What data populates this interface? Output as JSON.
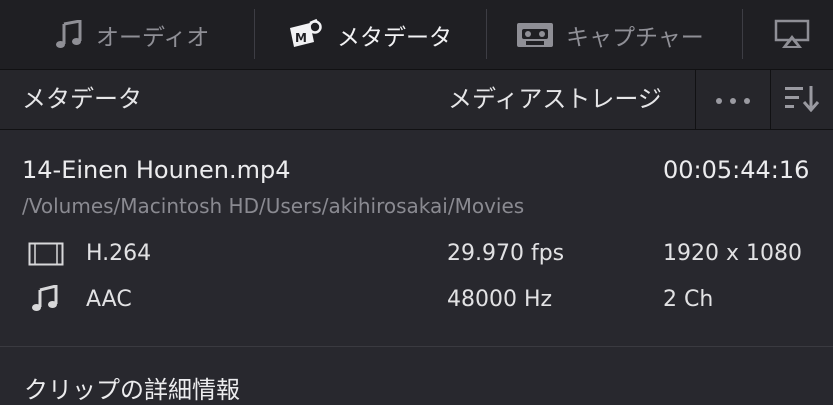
{
  "tabs": [
    {
      "label": "オーディオ",
      "icon": "music-note-icon",
      "active": false
    },
    {
      "label": "メタデータ",
      "icon": "metadata-tag-icon",
      "active": true
    },
    {
      "label": "キャプチャー",
      "icon": "cassette-icon",
      "active": false
    }
  ],
  "header": {
    "title": "メタデータ",
    "storage_label": "メディアストレージ"
  },
  "clip": {
    "filename": "14-Einen Hounen.mp4",
    "duration": "00:05:44:16",
    "path": "/Volumes/Macintosh HD/Users/akihirosakai/Movies",
    "video": {
      "codec": "H.264",
      "frame_rate": "29.970 fps",
      "resolution": "1920 x 1080"
    },
    "audio": {
      "codec": "AAC",
      "sample_rate": "48000 Hz",
      "channels": "2 Ch"
    }
  },
  "section": {
    "title": "クリップの詳細情報"
  },
  "colors": {
    "background": "#28282e",
    "topbar": "#1f1f23",
    "active_text": "#f2f2f4",
    "inactive_text": "#8f8f96"
  }
}
